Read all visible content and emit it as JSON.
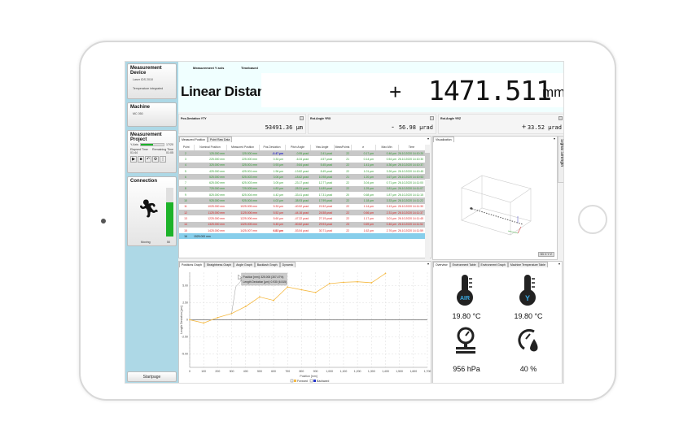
{
  "sidebar": {
    "device": {
      "title": "Measurement Device",
      "laser": "Laser IDS 2010",
      "temp": "Temperature integrated"
    },
    "machine": {
      "title": "Machine",
      "name": "MC 050"
    },
    "project": {
      "title": "Measurement Project",
      "axis": "Y-Axis",
      "axis_value": "17/20",
      "progress": 0.55,
      "elapsed_label": "Elapsed Time",
      "elapsed": "01:44",
      "remaining_label": "Remaining Time",
      "remaining": "01:05"
    },
    "connection": {
      "title": "Connection",
      "status": "Moving",
      "signal": "50",
      "signal_level": 0.7,
      "color": "#1db32a"
    },
    "startpage": "Startpage"
  },
  "top": {
    "axis_label": "Measurement Y axis",
    "mode": "Timebased",
    "title": "Linear Distance",
    "sign": "+",
    "value": "1471.511",
    "unit": "mm"
  },
  "readouts": [
    {
      "label": "Pos.Deviation YTY",
      "sign": "-",
      "value": "53491.36 µm"
    },
    {
      "label": "Rot.Angle YRX",
      "sign": "-",
      "value": "56.98 µrad"
    },
    {
      "label": "Rot.Angle YRZ",
      "sign": "+",
      "value": "33.52 µrad"
    }
  ],
  "table": {
    "tabs": [
      "Measured Position",
      "Point Raw Data"
    ],
    "columns": [
      "Point",
      "Nominal Position",
      "Measured Position",
      "Pos.Deviation",
      "Pitch Angle",
      "Yaw Angle",
      "MeasPoints",
      "σ",
      "Max-Min",
      "Time"
    ],
    "rows": [
      [
        "2",
        "125.000 mm",
        "125.000 mm",
        "-0.47 µm",
        "-0.95 µrad",
        "2.41 µrad",
        "22",
        "0.17 µm",
        "0.46 µm",
        "26.10.2020 14:10:20"
      ],
      [
        "3",
        "225.000 mm",
        "225.000 mm",
        "0.33 µm",
        "-6.34 µrad",
        "4.57 µrad",
        "21",
        "0.14 µm",
        "0.54 µm",
        "26.10.2020 14:10:30"
      ],
      [
        "4",
        "325.000 mm",
        "325.001 mm",
        "0.93 µm",
        "-9.84 µrad",
        "5.45 µrad",
        "22",
        "1.41 µm",
        "4.36 µm",
        "26.10.2020 14:10:37"
      ],
      [
        "5",
        "425.000 mm",
        "425.001 mm",
        "1.96 µm",
        "-13.82 µrad",
        "8.49 µrad",
        "22",
        "1.01 µm",
        "3.26 µm",
        "26.10.2020 14:10:45"
      ],
      [
        "6",
        "525.000 mm",
        "525.003 mm",
        "3.06 µm",
        "-18.62 µrad",
        "10.98 µrad",
        "21",
        "1.20 µm",
        "3.67 µm",
        "26.10.2020 14:10:53"
      ],
      [
        "7",
        "625.000 mm",
        "625.003 mm",
        "3.05 µm",
        "-23.17 µrad",
        "12.77 µrad",
        "22",
        "3.04 µm",
        "0.71 µm",
        "26.10.2020 14:11:00"
      ],
      [
        "8",
        "725.000 mm",
        "725.005 mm",
        "4.83 µm",
        "-28.31 µrad",
        "14.89 µrad",
        "22",
        "1.29 µm",
        "3.81 µm",
        "26.10.2020 14:11:07"
      ],
      [
        "9",
        "825.000 mm",
        "825.004 mm",
        "4.42 µm",
        "-33.41 µrad",
        "17.31 µrad",
        "20",
        "0.68 µm",
        "1.87 µm",
        "26.10.2020 14:11:15"
      ],
      [
        "10",
        "925.000 mm",
        "925.004 mm",
        "4.02 µm",
        "-38.93 µrad",
        "17.99 µrad",
        "22",
        "1.18 µm",
        "3.33 µm",
        "26.10.2020 14:11:22"
      ],
      [
        "11",
        "1025.000 mm",
        "1025.005 mm",
        "5.33 µm",
        "-40.52 µrad",
        "21.52 µrad",
        "22",
        "1.14 µm",
        "3.13 µm",
        "26.10.2020 14:11:30"
      ],
      [
        "12",
        "1125.000 mm",
        "1125.006 mm",
        "5.52 µm",
        "-44.16 µrad",
        "24.58 µrad",
        "22",
        "0.66 µm",
        "2.31 µm",
        "26.10.2020 14:11:37"
      ],
      [
        "13",
        "1225.000 mm",
        "1225.006 mm",
        "5.60 µm",
        "-47.22 µrad",
        "27.19 µrad",
        "22",
        "1.17 µm",
        "3.01 µm",
        "26.10.2020 14:11:45"
      ],
      [
        "14",
        "1325.000 mm",
        "1325.005 mm",
        "5.45 µm",
        "-50.82 µrad",
        "29.93 µrad",
        "23",
        "0.69 µm",
        "0.46 µm",
        "26.10.2020 14:11:52"
      ],
      [
        "15",
        "1425.000 mm",
        "1425.007 mm",
        "6.83 µm",
        "-53.54 µrad",
        "30.71 µrad",
        "22",
        "1.62 µm",
        "2.76 µm",
        "26.10.2020 14:11:59"
      ],
      [
        "16",
        "1525.000 mm",
        "",
        "",
        "",
        "",
        "",
        "",
        "",
        ""
      ]
    ],
    "row_status": [
      "ok",
      "ok",
      "ok",
      "ok",
      "ok",
      "ok",
      "ok",
      "ok",
      "ok",
      "out",
      "out",
      "out",
      "out",
      "out",
      "pending"
    ],
    "colors": {
      "ok": "#2e9a2e",
      "out": "#dd2222",
      "selected": "#87ceeb"
    }
  },
  "visualization": {
    "tab": "Visualization",
    "side_tab": "Signal Strength",
    "view_btn": "3D X Y Z"
  },
  "graph": {
    "tabs": [
      "Positions Graph",
      "Straightness Graph",
      "Angle Graph",
      "Backlash Graph",
      "Dynamic"
    ],
    "tooltip": [
      "Position [mm]: 325.000 (307.47%)",
      "Length Deviation [µm]: 0.930 (6.515)"
    ]
  },
  "chart_data": {
    "type": "line",
    "xlabel": "Position [mm]",
    "ylabel": "Length Deviation [µm]",
    "xlim": [
      0,
      1700
    ],
    "ylim": [
      -7,
      7
    ],
    "xticks": [
      0,
      100,
      200,
      300,
      400,
      500,
      600,
      700,
      800,
      900,
      1000,
      1100,
      1200,
      1300,
      1400,
      1500,
      1600,
      1700
    ],
    "xtick_labels": [
      "0",
      "100",
      "200",
      "300",
      "400",
      "500",
      "600",
      "700",
      "800",
      "900",
      "1,000",
      "1,100",
      "1,200",
      "1,300",
      "1,400",
      "1,500",
      "1,600",
      "1,700"
    ],
    "yticks": [
      5,
      2.5,
      0,
      -2.5,
      -5
    ],
    "ytick_labels": [
      "5.00",
      "2.50",
      "0",
      "-2.50",
      "-5.00"
    ],
    "grid": true,
    "legend": "bottom",
    "series": [
      {
        "name": "Forward",
        "color": "#f5b942",
        "x": [
          0,
          100,
          200,
          300,
          400,
          500,
          600,
          700,
          800,
          900,
          1000,
          1100,
          1200,
          1300,
          1400
        ],
        "values": [
          0,
          -0.47,
          0.33,
          0.93,
          1.96,
          3.36,
          2.86,
          4.83,
          4.42,
          4.02,
          5.33,
          5.52,
          5.6,
          5.45,
          6.83
        ]
      },
      {
        "name": "Backward",
        "color": "#2233cc",
        "x": [],
        "values": []
      }
    ]
  },
  "environment": {
    "tabs": [
      "Overview",
      "Environment Table",
      "Environment Graph",
      "Machine Temperature Table"
    ],
    "air_label": "AIR",
    "axis_label": "Y",
    "air_temp": "19.80 °C",
    "axis_temp": "19.80 °C",
    "pressure": "956 hPa",
    "humidity": "40 %",
    "accent": "#3aa8e0"
  }
}
